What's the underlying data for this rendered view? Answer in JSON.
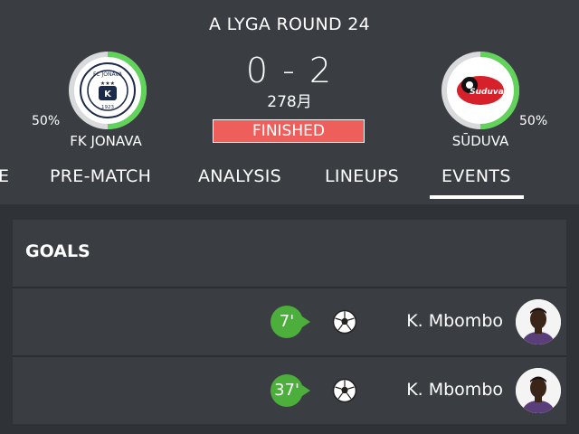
{
  "match": {
    "round_title": "A LYGA ROUND 24",
    "score": "0 - 2",
    "date": "278月",
    "status": "FINISHED"
  },
  "home": {
    "name": "FK JONAVA",
    "percent_label": "50%",
    "possession_fraction": 0.5,
    "logo_icon": "fk-jonava-crest"
  },
  "away": {
    "name": "SŪDUVA",
    "percent_label": "50%",
    "possession_fraction": 0.5,
    "logo_icon": "suduva-crest"
  },
  "tabs": [
    {
      "label": "E"
    },
    {
      "label": "PRE-MATCH"
    },
    {
      "label": "ANALYSIS"
    },
    {
      "label": "LINEUPS"
    },
    {
      "label": "EVENTS",
      "active": true
    }
  ],
  "goals": {
    "title": "GOALS",
    "events": [
      {
        "minute": "7'",
        "player": "K. Mbombo",
        "icon": "soccer-ball-icon"
      },
      {
        "minute": "37'",
        "player": "K. Mbombo",
        "icon": "soccer-ball-icon"
      }
    ]
  },
  "colors": {
    "accent_green": "#4cae3b",
    "progress_green": "#62d35a",
    "status_red": "#ee5f5c",
    "header_bg": "#3a3d41",
    "page_bg": "#2f3236"
  }
}
